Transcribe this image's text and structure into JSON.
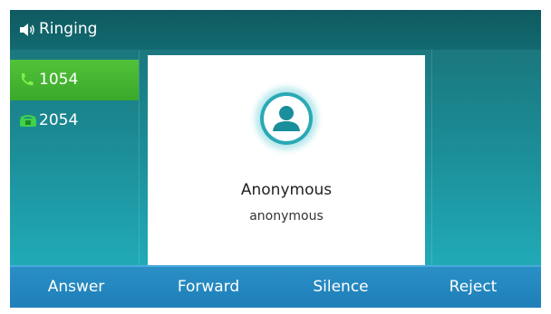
{
  "status": {
    "icon": "speaker-icon",
    "text": "Ringing"
  },
  "lines": [
    {
      "label": "1054",
      "icon": "handset-icon",
      "active": true
    },
    {
      "label": "2054",
      "icon": "desk-phone-icon",
      "active": false
    }
  ],
  "caller": {
    "icon": "contact-avatar-icon",
    "name": "Anonymous",
    "number": "anonymous"
  },
  "softkeys": [
    {
      "label": "Answer"
    },
    {
      "label": "Forward"
    },
    {
      "label": "Silence"
    },
    {
      "label": "Reject"
    }
  ],
  "colors": {
    "accent_green": "#3aa82a",
    "softkey_blue": "#1f7fb8",
    "screen_teal": "#1a7d84"
  }
}
